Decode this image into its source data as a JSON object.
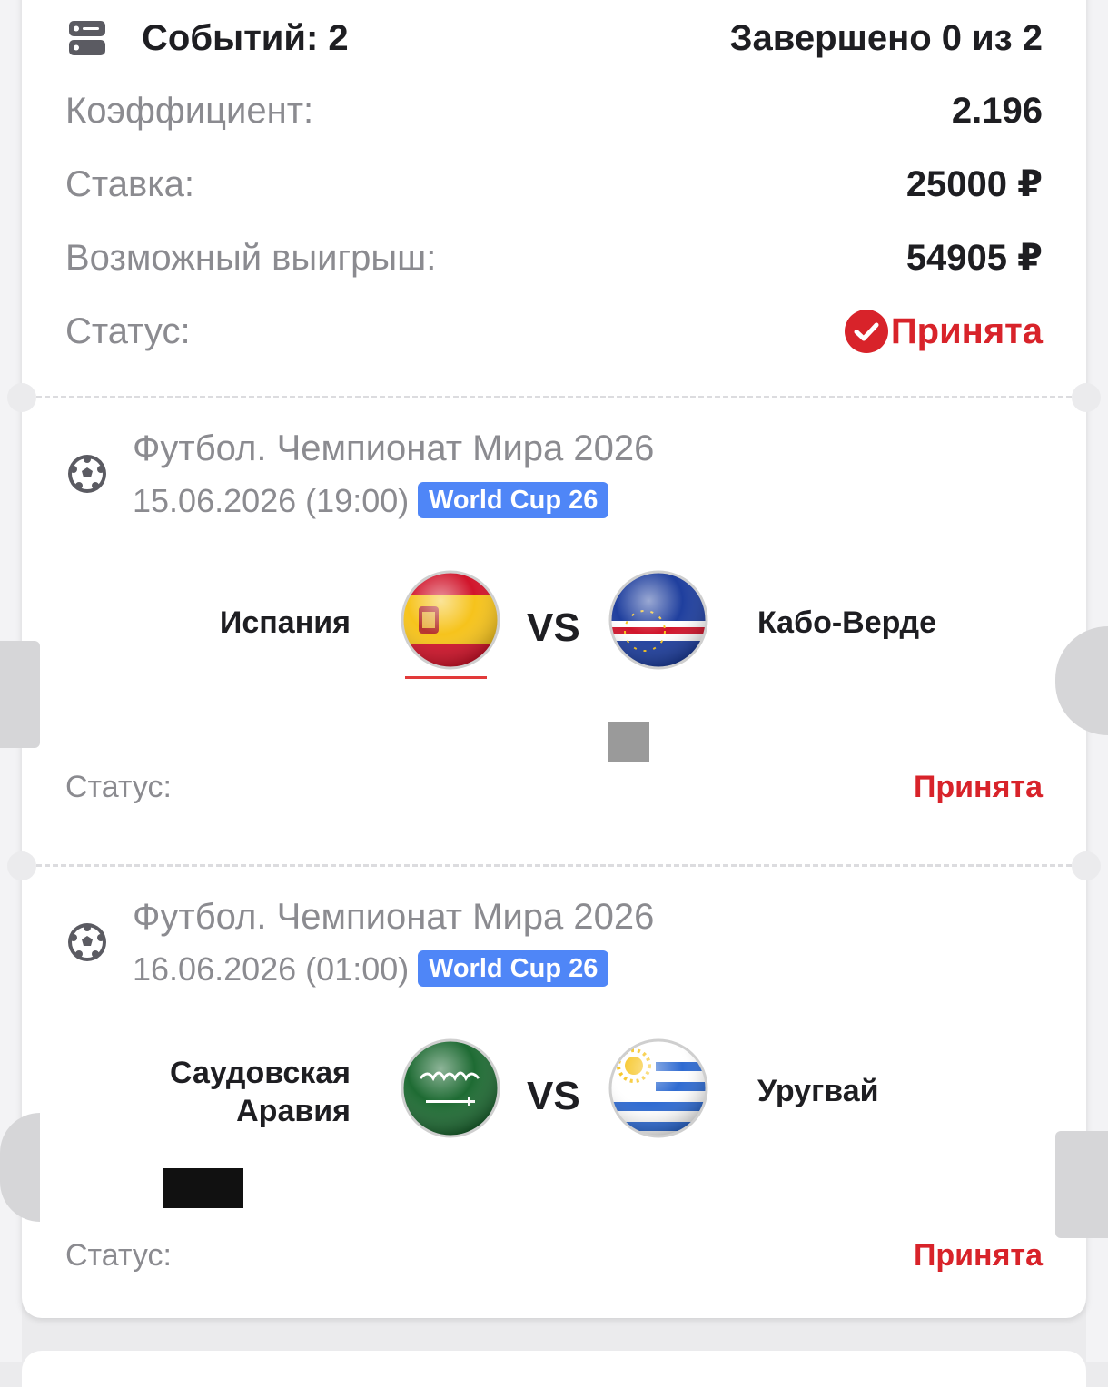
{
  "summary": {
    "events_label": "Событий: 2",
    "completed_label": "Завершено 0 из 2",
    "coef_label": "Коэффициент:",
    "coef_value": "2.196",
    "stake_label": "Ставка:",
    "stake_value": "25000 ₽",
    "win_label": "Возможный выигрыш:",
    "win_value": "54905 ₽",
    "status_label": "Статус:",
    "status_value": "Принята",
    "status_icon": "check-circle-icon",
    "status_color": "#d8232a"
  },
  "events": [
    {
      "league": "Футбол. Чемпионат Мира 2026",
      "date": "15.06.2026 (19:00)",
      "badge": "World Cup 26",
      "team_home": "Испания",
      "team_away": "Кабо-Верде",
      "vs": "VS",
      "status_label": "Статус:",
      "status_value": "Принята"
    },
    {
      "league": "Футбол. Чемпионат Мира 2026",
      "date": "16.06.2026 (01:00)",
      "badge": "World Cup 26",
      "team_home_line1": "Саудовская",
      "team_home_line2": "Аравия",
      "team_away": "Уругвай",
      "vs": "VS",
      "status_label": "Статус:",
      "status_value": "Принята"
    }
  ],
  "colors": {
    "accent_blue": "#4f86f7",
    "status_red": "#d8232a",
    "text_dark": "#1e1e22",
    "text_muted": "#8b8b90"
  }
}
